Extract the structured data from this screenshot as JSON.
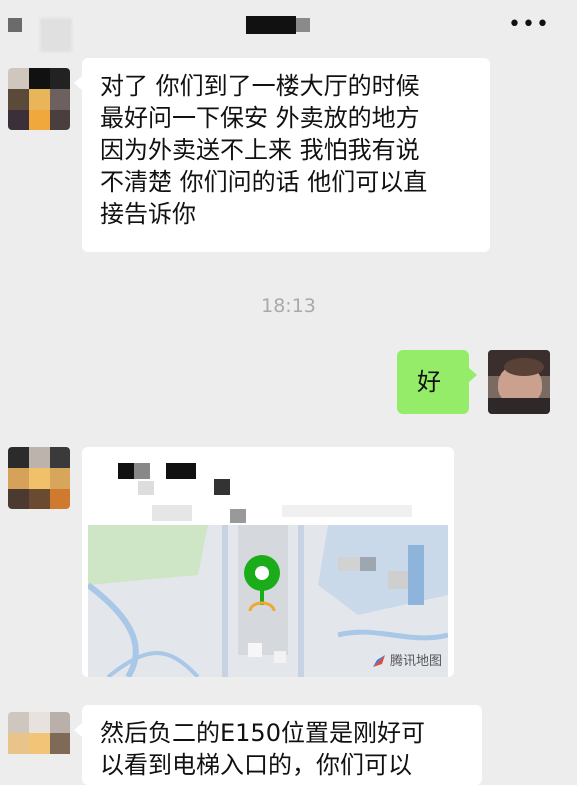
{
  "messages": {
    "m1": "对了 你们到了一楼大厅的时候\n最好问一下保安 外卖放的地方\n因为外卖送不上来 我怕我有说\n不清楚 你们问的话 他们可以直\n接告诉你",
    "time": "18:13",
    "m2": "好",
    "m4": "然后负二的E150位置是刚好可\n以看到电梯入口的，你们可以"
  },
  "map": {
    "provider": "腾讯地图",
    "pin_color": "#1aad19"
  },
  "icons": {
    "more": "more-icon"
  },
  "colors": {
    "background": "#ededed",
    "sent_bubble": "#95ec69",
    "received_bubble": "#ffffff"
  }
}
